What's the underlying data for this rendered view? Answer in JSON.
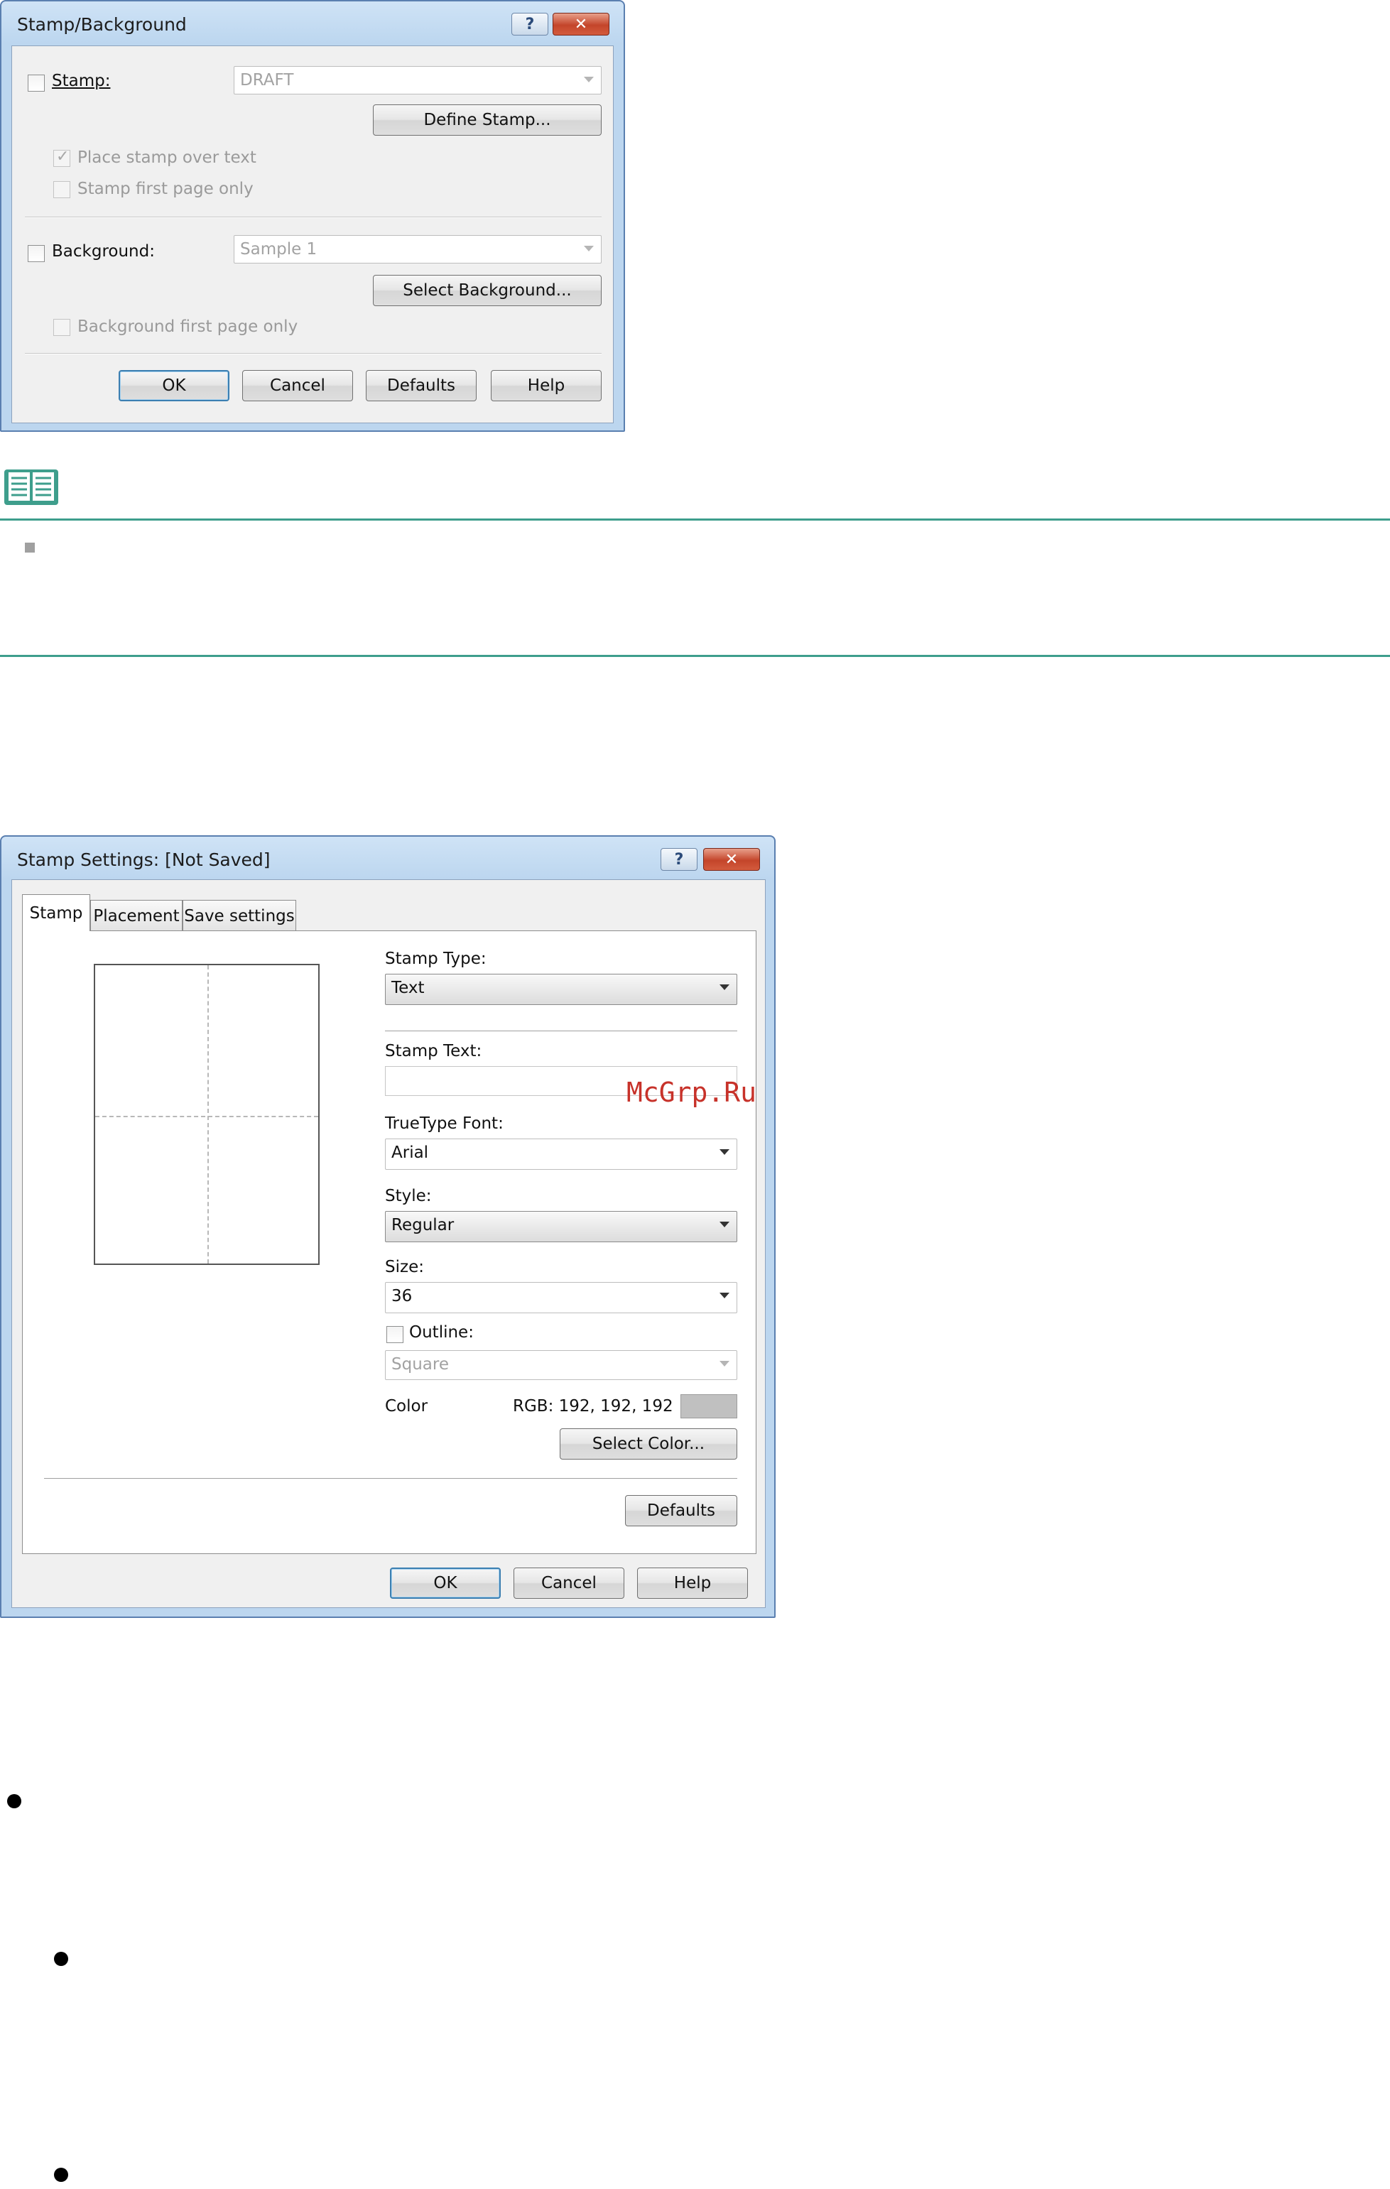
{
  "dialog1": {
    "title": "Stamp/Background",
    "help_label": "?",
    "close_label": "✕",
    "stamp_label": "Stamp:",
    "stamp_value": "DRAFT",
    "define_stamp_label": "Define Stamp...",
    "place_over_text_label": "Place stamp over text",
    "stamp_first_page_label": "Stamp first page only",
    "background_label": "Background:",
    "background_value": "Sample 1",
    "select_background_label": "Select Background...",
    "background_first_page_label": "Background first page only",
    "ok_label": "OK",
    "cancel_label": "Cancel",
    "defaults_label": "Defaults",
    "help_button_label": "Help"
  },
  "dialog2": {
    "title": "Stamp Settings: [Not Saved]",
    "help_label": "?",
    "close_label": "✕",
    "tabs": [
      "Stamp",
      "Placement",
      "Save settings"
    ],
    "stamp_type_label": "Stamp Type:",
    "stamp_type_value": "Text",
    "stamp_text_label": "Stamp Text:",
    "stamp_text_value": "",
    "font_label": "TrueType Font:",
    "font_value": "Arial",
    "style_label": "Style:",
    "style_value": "Regular",
    "size_label": "Size:",
    "size_value": "36",
    "outline_label": "Outline:",
    "outline_value": "Square",
    "color_label": "Color",
    "color_rgb": "RGB: 192, 192, 192",
    "color_swatch": "#c0c0c0",
    "select_color_label": "Select Color...",
    "defaults_label": "Defaults",
    "ok_label": "OK",
    "cancel_label": "Cancel",
    "help_button_label": "Help"
  },
  "watermark": "McGrp.Ru",
  "colors": {
    "note_rule": "#3e9e8c",
    "note_icon": "#3e9e8c",
    "title_bar": "#c6dcf2",
    "close_button": "#c4452a"
  }
}
